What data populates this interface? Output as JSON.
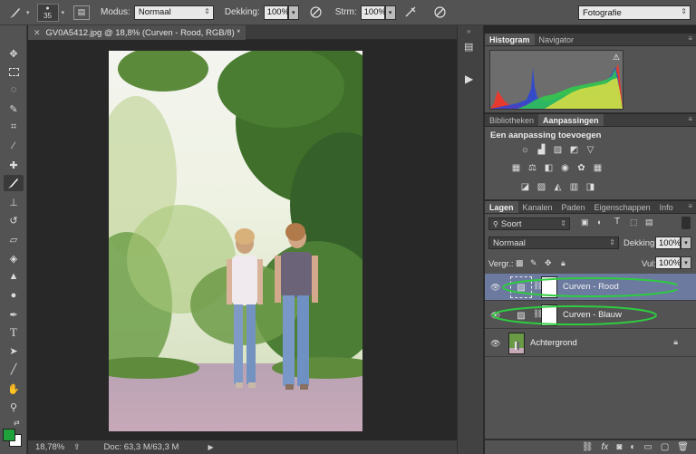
{
  "options_bar": {
    "brush_size": "35",
    "mode_label": "Modus:",
    "mode_value": "Normaal",
    "opacity_label": "Dekking:",
    "opacity_value": "100%",
    "flow_label": "Strm:",
    "flow_value": "100%",
    "workspace_value": "Fotografie"
  },
  "document": {
    "tab_title": "GV0A5412.jpg @ 18,8% (Curven - Rood, RGB/8) *"
  },
  "status_bar": {
    "zoom": "18,78%",
    "doc_info": "Doc: 63,3 M/63,3 M"
  },
  "histogram_panel": {
    "tabs": [
      "Histogram",
      "Navigator"
    ],
    "warning_icon": "warning-icon"
  },
  "adjustments_panel": {
    "tabs": [
      "Bibliotheken",
      "Aanpassingen"
    ],
    "title": "Een aanpassing toevoegen"
  },
  "layers_panel": {
    "tabs": [
      "Lagen",
      "Kanalen",
      "Paden",
      "Eigenschappen",
      "Info"
    ],
    "filter_value": "Soort",
    "blend_mode": "Normaal",
    "opacity_label": "Dekking:",
    "opacity_value": "100%",
    "lock_label": "Vergr.:",
    "fill_label": "Vul:",
    "fill_value": "100%",
    "layers": [
      {
        "name": "Curven - Rood",
        "selected": true
      },
      {
        "name": "Curven - Blauw",
        "selected": false
      },
      {
        "name": "Achtergrond",
        "selected": false
      }
    ]
  },
  "colors": {
    "foreground": "#1fa23a",
    "background": "#ffffff",
    "annotation": "#2ecc40",
    "selection": "#6c7aa0"
  }
}
